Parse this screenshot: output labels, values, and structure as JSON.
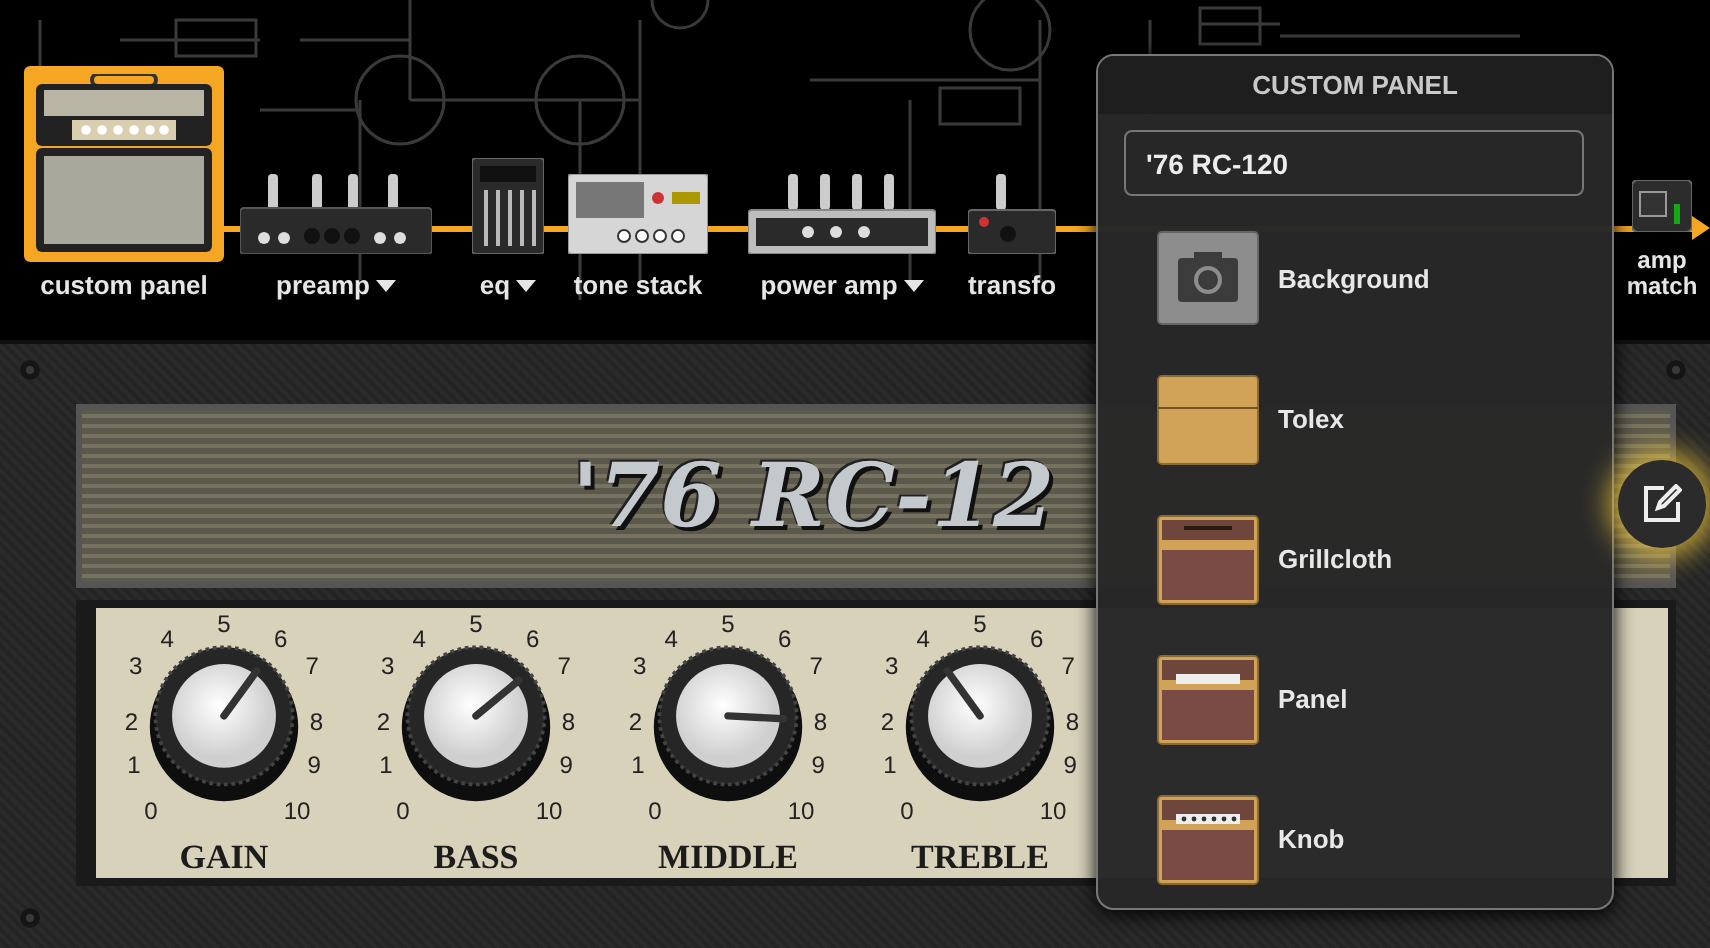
{
  "chain": [
    {
      "label": "custom panel",
      "kind": "combo",
      "selected": true,
      "dropdown": false
    },
    {
      "label": "preamp",
      "kind": "preamp",
      "selected": false,
      "dropdown": true
    },
    {
      "label": "eq",
      "kind": "eq",
      "selected": false,
      "dropdown": true
    },
    {
      "label": "tone stack",
      "kind": "tonestack",
      "selected": false,
      "dropdown": false
    },
    {
      "label": "power amp",
      "kind": "poweramp",
      "selected": false,
      "dropdown": true
    },
    {
      "label": "transfo",
      "kind": "transformer",
      "selected": false,
      "dropdown": false
    },
    {
      "label": "amp match",
      "kind": "ampmatch",
      "selected": false,
      "dropdown": false
    }
  ],
  "amp": {
    "name": "'76 RC-12",
    "knobs": [
      {
        "label": "GAIN",
        "level": 0.6,
        "scale": [
          "5",
          "4",
          "6",
          "3",
          "7",
          "2",
          "8",
          "1",
          "9",
          "0",
          "10"
        ]
      },
      {
        "label": "BASS",
        "level": 0.66,
        "scale": [
          "5",
          "4",
          "6",
          "3",
          "7",
          "2",
          "8",
          "1",
          "9",
          "0",
          "10"
        ]
      },
      {
        "label": "MIDDLE",
        "level": 0.8,
        "scale": [
          "5",
          "4",
          "6",
          "3",
          "7",
          "2",
          "8",
          "1",
          "9",
          "0",
          "10"
        ]
      },
      {
        "label": "TREBLE",
        "level": 0.4,
        "scale": [
          "5",
          "4",
          "6",
          "3",
          "7",
          "2",
          "8",
          "1",
          "9",
          "0",
          "10"
        ]
      }
    ]
  },
  "popup": {
    "title": "CUSTOM PANEL",
    "name_field": {
      "value": "'76 RC-120"
    },
    "items": [
      {
        "label": "Background",
        "kind": "background"
      },
      {
        "label": "Tolex",
        "kind": "tolex"
      },
      {
        "label": "Grillcloth",
        "kind": "grillcloth"
      },
      {
        "label": "Panel",
        "kind": "panel"
      },
      {
        "label": "Knob",
        "kind": "knob"
      }
    ]
  }
}
